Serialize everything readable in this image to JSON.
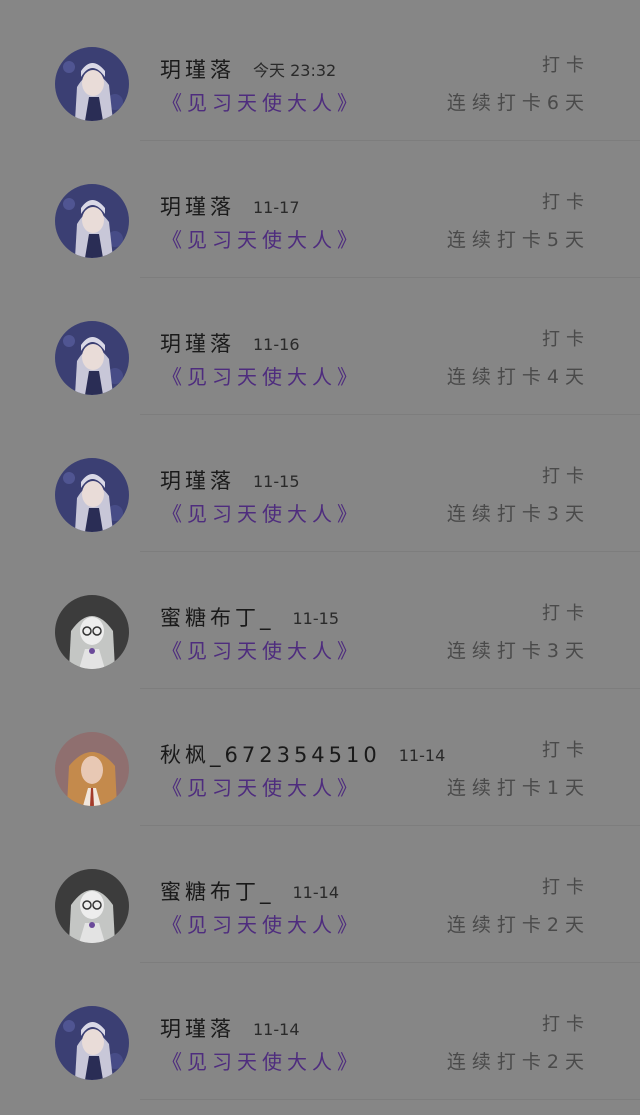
{
  "items": [
    {
      "name": "玥瑾落",
      "date": "今天 23:32",
      "title": "《见习天使大人》",
      "action": "打卡",
      "streak": "连续打卡6天",
      "avatar_icon": "avatar-silver-hair-girl-icon",
      "avatar_bg": "#3b3f73"
    },
    {
      "name": "玥瑾落",
      "date": "11-17",
      "title": "《见习天使大人》",
      "action": "打卡",
      "streak": "连续打卡5天",
      "avatar_icon": "avatar-silver-hair-girl-icon",
      "avatar_bg": "#3b3f73"
    },
    {
      "name": "玥瑾落",
      "date": "11-16",
      "title": "《见习天使大人》",
      "action": "打卡",
      "streak": "连续打卡4天",
      "avatar_icon": "avatar-silver-hair-girl-icon",
      "avatar_bg": "#3b3f73"
    },
    {
      "name": "玥瑾落",
      "date": "11-15",
      "title": "《见习天使大人》",
      "action": "打卡",
      "streak": "连续打卡3天",
      "avatar_icon": "avatar-silver-hair-girl-icon",
      "avatar_bg": "#3b3f73"
    },
    {
      "name": "蜜糖布丁_",
      "date": "11-15",
      "title": "《见习天使大人》",
      "action": "打卡",
      "streak": "连续打卡3天",
      "avatar_icon": "avatar-glasses-girl-icon",
      "avatar_bg": "#3c3c3c"
    },
    {
      "name": "秋枫_672354510",
      "date": "11-14",
      "title": "《见习天使大人》",
      "action": "打卡",
      "streak": "连续打卡1天",
      "avatar_icon": "avatar-orange-hair-girl-icon",
      "avatar_bg": "#8f6f6f"
    },
    {
      "name": "蜜糖布丁_",
      "date": "11-14",
      "title": "《见习天使大人》",
      "action": "打卡",
      "streak": "连续打卡2天",
      "avatar_icon": "avatar-glasses-girl-icon",
      "avatar_bg": "#3c3c3c"
    },
    {
      "name": "玥瑾落",
      "date": "11-14",
      "title": "《见习天使大人》",
      "action": "打卡",
      "streak": "连续打卡2天",
      "avatar_icon": "avatar-silver-hair-girl-icon",
      "avatar_bg": "#3b3f73"
    }
  ],
  "colors": {
    "overlay_background": "#868686",
    "title_accent": "#4e2c7e"
  }
}
